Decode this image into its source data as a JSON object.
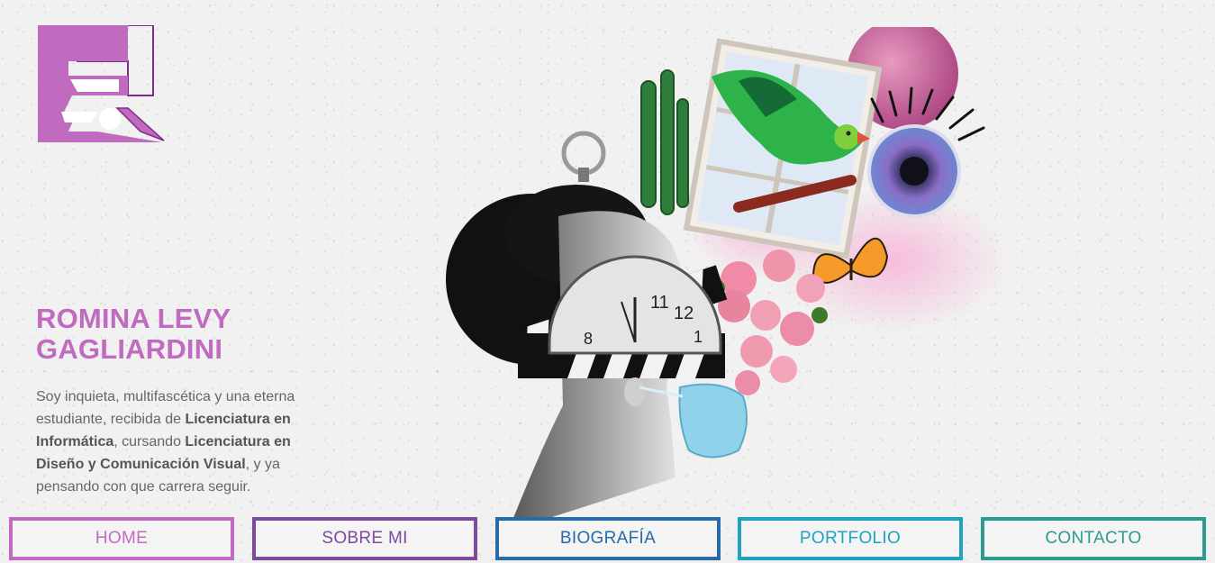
{
  "logo": {
    "icon": "rl-monogram-logo",
    "color": "#c06ac0",
    "outline": "#7a2d8a"
  },
  "hero": {
    "name_line1": "ROMINA LEVY",
    "name_line2": "GAGLIARDINI",
    "bio": {
      "p1": "Soy inquieta, multifascética y una eterna estudiante, recibida de ",
      "b1": "Licenciatura en Informática",
      "p2": ", cursando ",
      "b2": "Licenciatura en Diseño y Comunicación Visual",
      "p3": ", y ya pensando con que carrera seguir."
    },
    "illustration": "collage-woman-profile-illustration",
    "clock_numbers": [
      "11",
      "12",
      "1",
      "8"
    ]
  },
  "nav": {
    "items": [
      {
        "label": "HOME",
        "color": "#c06ac0"
      },
      {
        "label": "SOBRE MI",
        "color": "#7e4a9c"
      },
      {
        "label": "BIOGRAFÍA",
        "color": "#2a6aa8"
      },
      {
        "label": "PORTFOLIO",
        "color": "#1fa3c0"
      },
      {
        "label": "CONTACTO",
        "color": "#2d9a92"
      }
    ]
  }
}
